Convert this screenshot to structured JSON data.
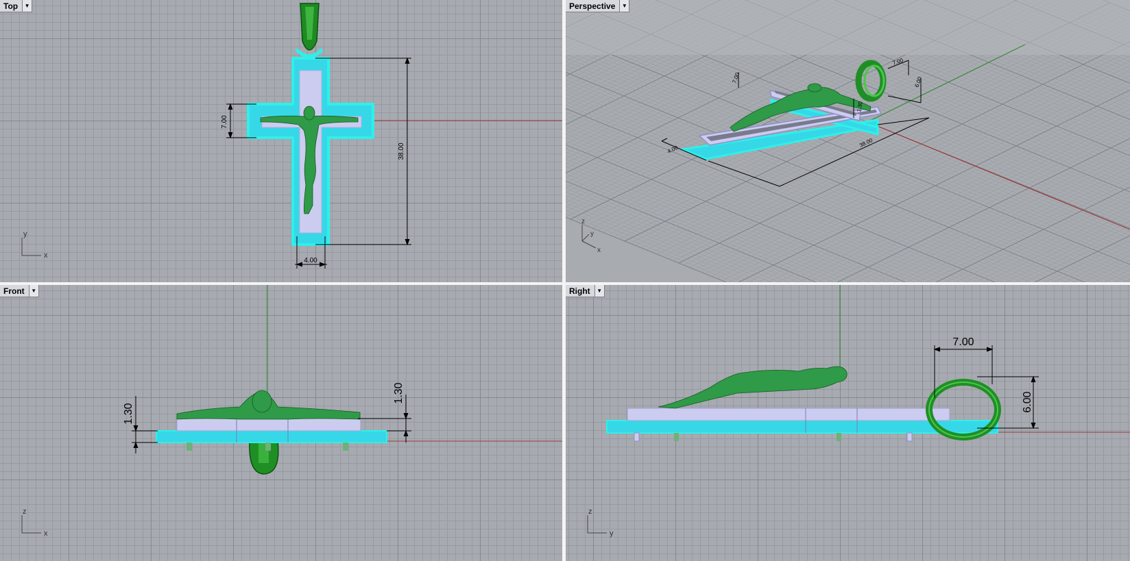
{
  "viewports": {
    "top": {
      "title": "Top"
    },
    "persp": {
      "title": "Perspective"
    },
    "front": {
      "title": "Front"
    },
    "right": {
      "title": "Right"
    }
  },
  "axes": {
    "x": "x",
    "y": "y",
    "z": "z"
  },
  "dimensions": {
    "top": {
      "arm_height": "7.00",
      "length": "38.00",
      "width": "4.00"
    },
    "persp": {
      "bail_width": "7.00",
      "bail_height": "6.00",
      "length": "38.00",
      "width": "4.00",
      "arm_height": "7.00",
      "thickness1": "1.30",
      "thickness2": "1.30"
    },
    "front": {
      "thickness_left": "1.30",
      "thickness_right": "1.30"
    },
    "right": {
      "bail_width": "7.00",
      "bail_height": "6.00"
    }
  },
  "colors": {
    "grid_bg": "#a7aab0",
    "x_axis": "#9b3a3a",
    "y_axis": "#3c8a3c",
    "highlight": "#2ef0ea",
    "cross_fill": "#ccccf0",
    "figure": "#2f9a47",
    "bail": "#1f8f25"
  },
  "icons": {
    "dropdown": "triangle-down",
    "world_axes": "axes-gizmo"
  }
}
